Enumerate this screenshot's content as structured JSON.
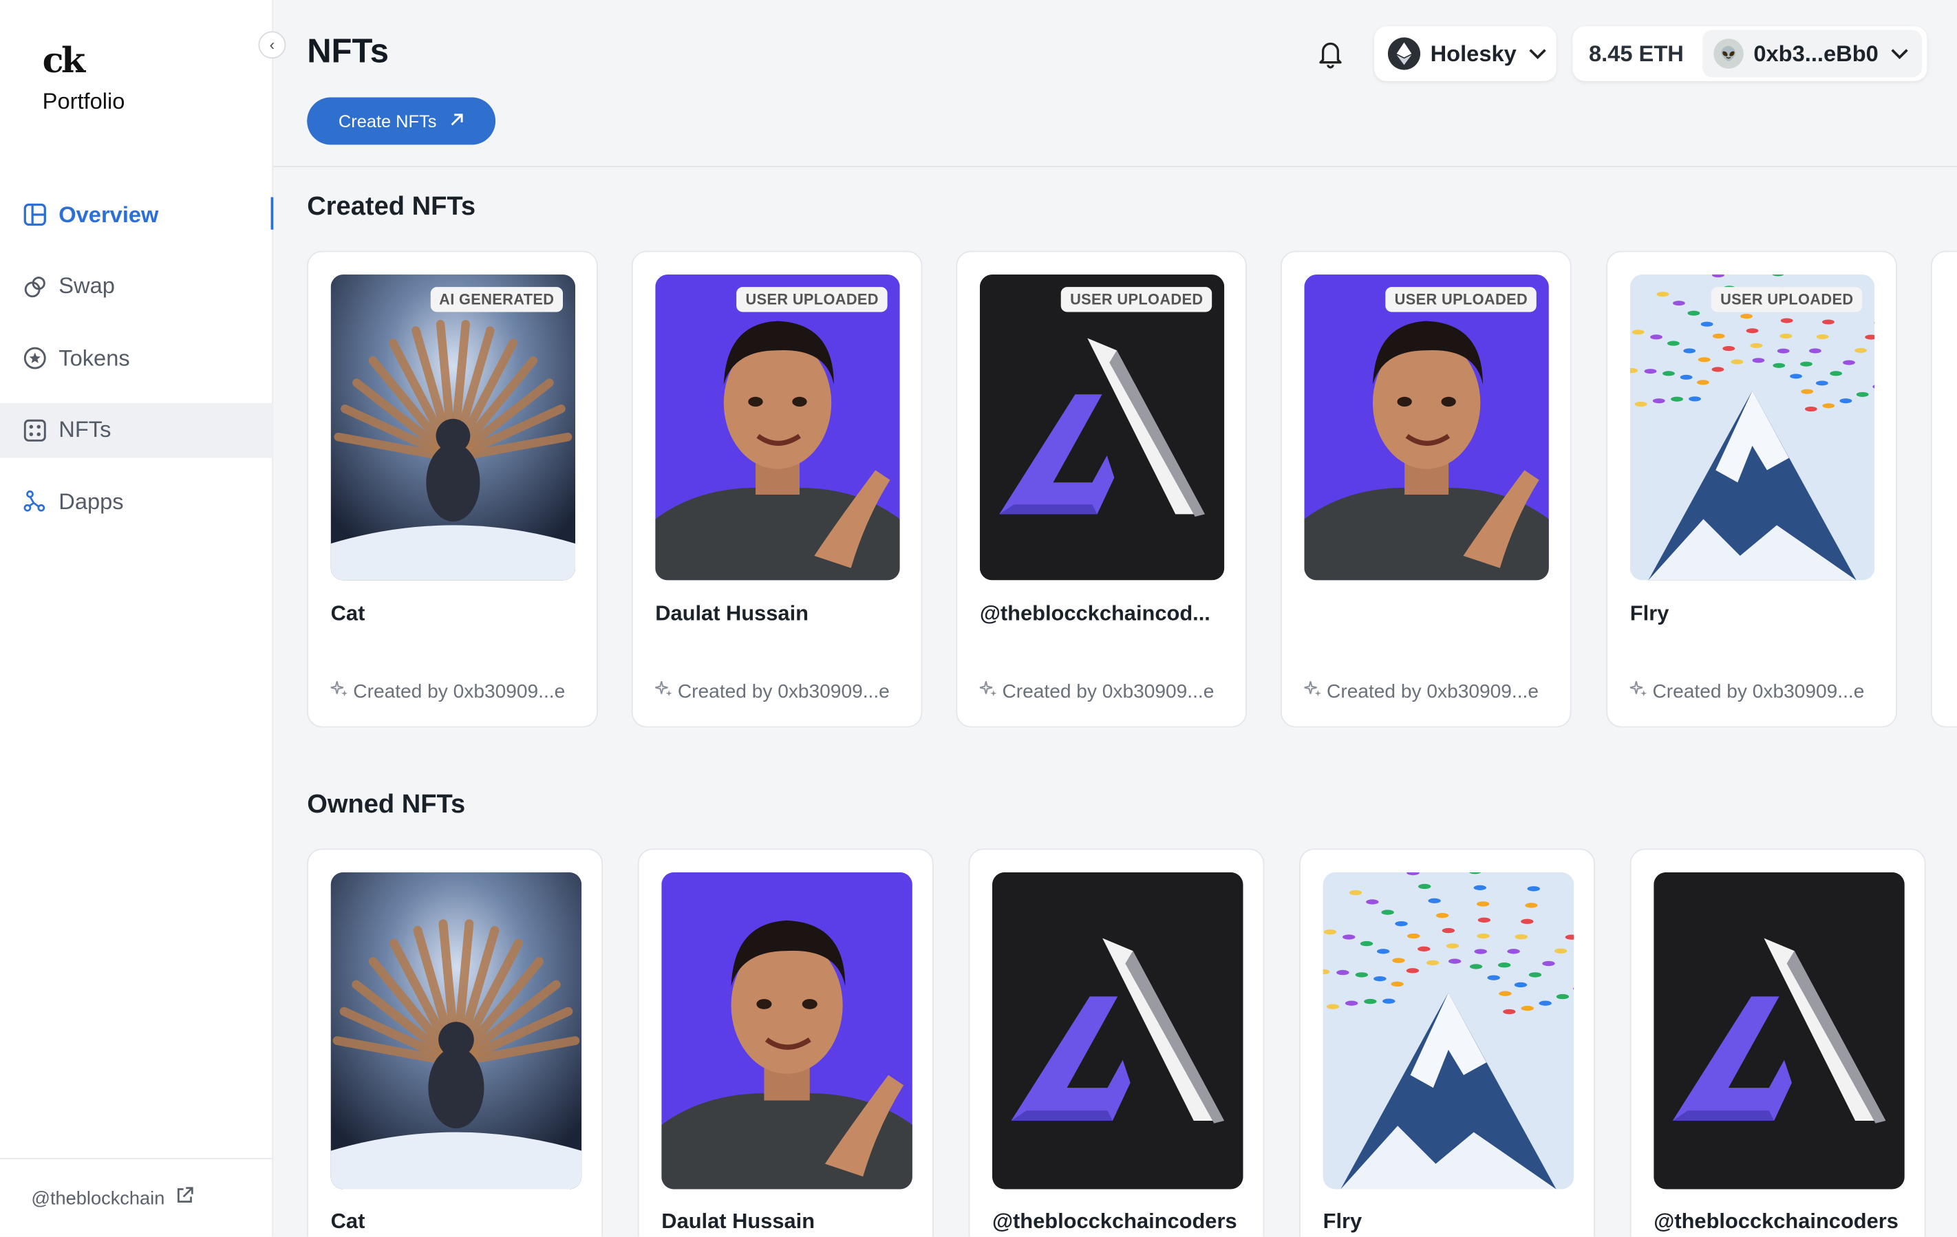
{
  "sidebar": {
    "logo_mark": "ck",
    "logo_text": "Portfolio",
    "items": [
      {
        "label": "Overview",
        "icon": "layout-icon"
      },
      {
        "label": "Swap",
        "icon": "swap-icon"
      },
      {
        "label": "Tokens",
        "icon": "token-icon"
      },
      {
        "label": "NFTs",
        "icon": "grid-icon"
      },
      {
        "label": "Dapps",
        "icon": "network-icon"
      }
    ],
    "footer_link": "@theblockchain"
  },
  "header": {
    "title": "NFTs",
    "create_button": "Create NFTs",
    "network": "Holesky",
    "balance": "8.45 ETH",
    "address": "0xb3...eBb0"
  },
  "created": {
    "title": "Created NFTs",
    "cards": [
      {
        "name": "Cat",
        "badge": "AI GENERATED",
        "creator": "Created by 0xb30909...e",
        "art": "cat"
      },
      {
        "name": "Daulat Hussain",
        "badge": "USER UPLOADED",
        "creator": "Created by 0xb30909...e",
        "art": "person"
      },
      {
        "name": "@theblocckchaincod...",
        "badge": "USER UPLOADED",
        "creator": "Created by 0xb30909...e",
        "art": "logo"
      },
      {
        "name": "",
        "badge": "USER UPLOADED",
        "creator": "Created by 0xb30909...e",
        "art": "person"
      },
      {
        "name": "Flry",
        "badge": "USER UPLOADED",
        "creator": "Created by 0xb30909...e",
        "art": "mountain"
      }
    ]
  },
  "owned": {
    "title": "Owned NFTs",
    "cards": [
      {
        "name": "Cat",
        "art": "cat"
      },
      {
        "name": "Daulat Hussain",
        "art": "person"
      },
      {
        "name": "@theblocckchaincoders",
        "art": "logo"
      },
      {
        "name": "Flry",
        "art": "mountain"
      },
      {
        "name": "@theblocckchaincoders",
        "art": "logo"
      }
    ]
  },
  "colors": {
    "accent": "#2f6fcd",
    "logo_purple": "#6a55e8"
  }
}
